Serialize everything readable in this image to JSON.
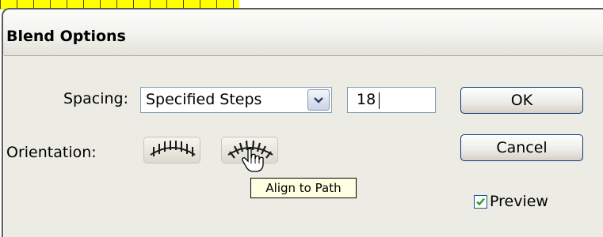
{
  "dialog": {
    "title": "Blend Options",
    "spacing": {
      "label": "Spacing:",
      "selected": "Specified Steps",
      "steps_value": "18"
    },
    "orientation": {
      "label": "Orientation:",
      "buttons": [
        {
          "name": "align-to-page",
          "icon": "align-to-page-icon"
        },
        {
          "name": "align-to-path",
          "icon": "align-to-path-icon"
        }
      ],
      "tooltip": "Align to Path"
    },
    "buttons": {
      "ok": "OK",
      "cancel": "Cancel"
    },
    "preview": {
      "label": "Preview",
      "checked": true
    }
  },
  "colors": {
    "highlight": "#ffff00",
    "dialog_bg": "#ecece4",
    "button_border": "#003c74",
    "checkbox_check": "#21a121"
  }
}
